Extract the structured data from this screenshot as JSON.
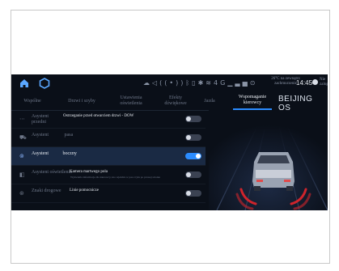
{
  "status_bar": {
    "temperature_text": "26°C na zewnątrz zachmurzenie",
    "time": "14:45",
    "user_label": "Nie zalogowano",
    "icons": [
      "cloud-icon",
      "volume-icon",
      "broadcast-icon",
      "bluetooth-icon",
      "battery-icon",
      "signal-icon",
      "wifi-icon",
      "network-4g-icon",
      "bars-icon",
      "location-icon"
    ],
    "network_label": "4G"
  },
  "tabs": [
    {
      "label": "Wspólne"
    },
    {
      "label": "Drzwi i szyby"
    },
    {
      "label": "Ustawienia oświetlenia"
    },
    {
      "label": "Efekty dźwiękowe"
    },
    {
      "label": "Jazda"
    },
    {
      "label": "Wspomaganie kierowcy",
      "active": true
    }
  ],
  "brand": "BEIJING OS",
  "rows": [
    {
      "icon": "front-assist-icon",
      "label": "Asystent przedni",
      "description": "Ostrzeganie przed otwarciem drzwi - DOW",
      "subtext": "",
      "on": false
    },
    {
      "icon": "lane-assist-icon",
      "label": "Asystent pasa",
      "description": "",
      "subtext": "",
      "on": false
    },
    {
      "icon": "side-assist-icon",
      "label": "Asystent boczny",
      "description": "",
      "subtext": "",
      "on": true
    },
    {
      "icon": "light-assist-icon",
      "label": "Asystent oświetlenia",
      "description": "Kamera martwego pola",
      "subtext": "Wyświetla informacje dla kierowcy, kto wjeżdża w pas z tyłu po prawej stronie",
      "on": false
    },
    {
      "icon": "traffic-sign-icon",
      "label": "Znaki drogowe",
      "description": "Linie pomocnicze",
      "subtext": "",
      "on": false
    }
  ],
  "colors": {
    "accent": "#2b8cff",
    "background": "#0a0f18",
    "warning": "#d0242c"
  }
}
